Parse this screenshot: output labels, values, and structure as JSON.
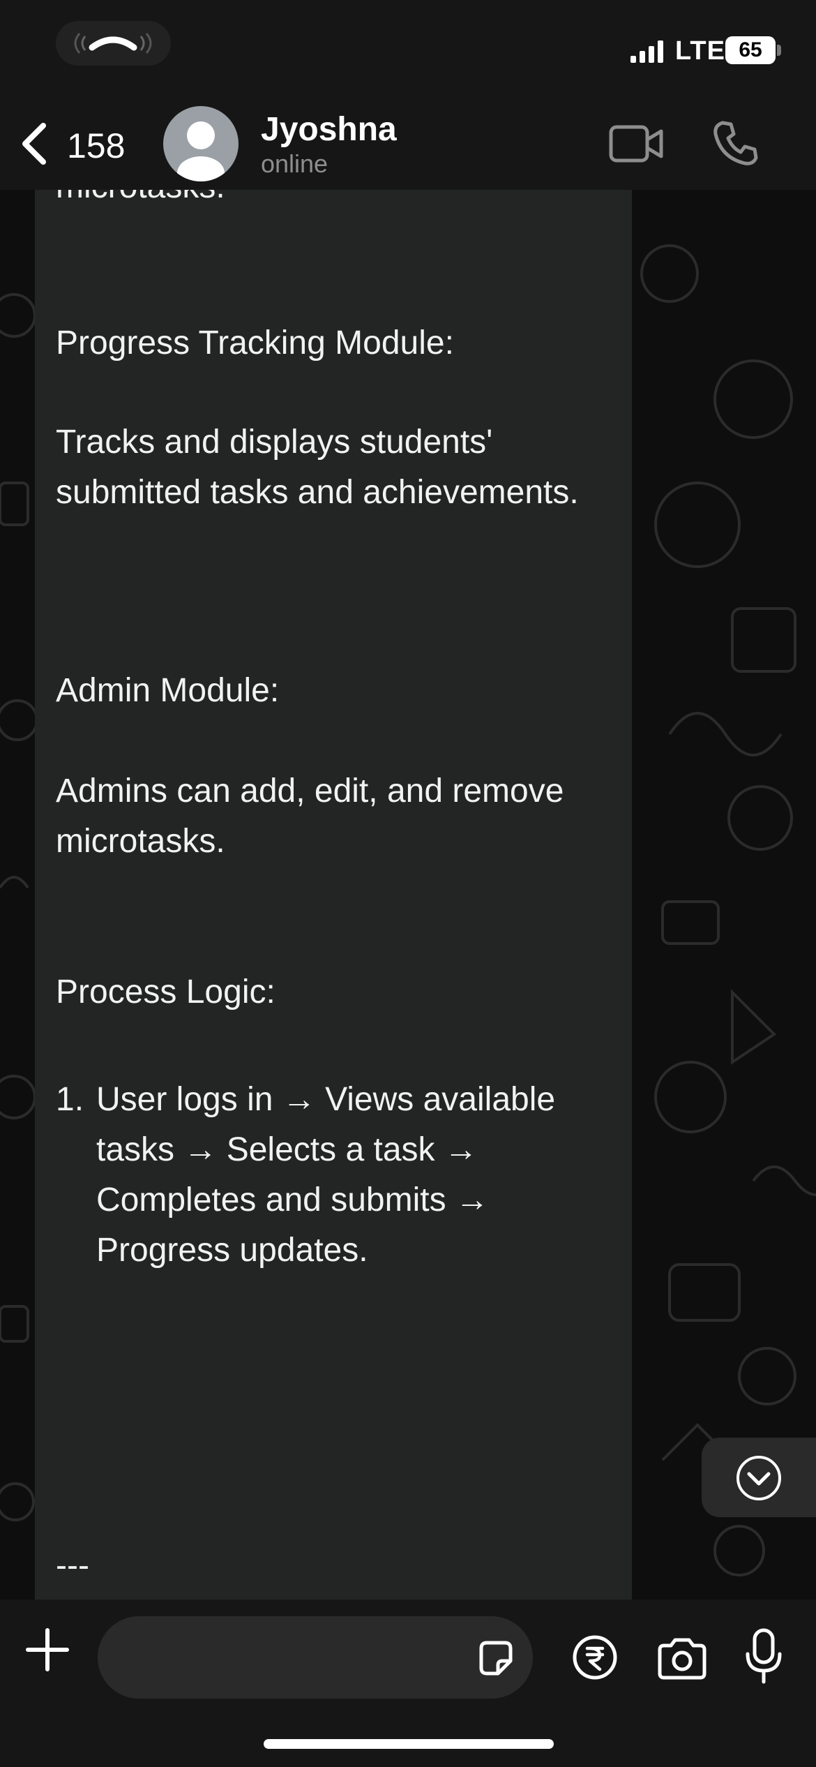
{
  "status_bar": {
    "network": "LTE",
    "battery": "65"
  },
  "header": {
    "back_count": "158",
    "contact_name": "Jyoshna",
    "contact_status": "online"
  },
  "message": {
    "top_fragment": "microtasks.",
    "heading_1": "Progress Tracking Module:",
    "para_1": "Tracks and displays students' submitted tasks and achievements.",
    "heading_2": "Admin Module:",
    "para_2": "Admins can add, edit, and remove microtasks.",
    "heading_3": "Process Logic:",
    "list_number": "1.",
    "list_item_1": "User logs in → Views available tasks → Selects a task → Completes and submits → Progress updates.",
    "separator": "---"
  },
  "composer": {
    "placeholder": ""
  }
}
